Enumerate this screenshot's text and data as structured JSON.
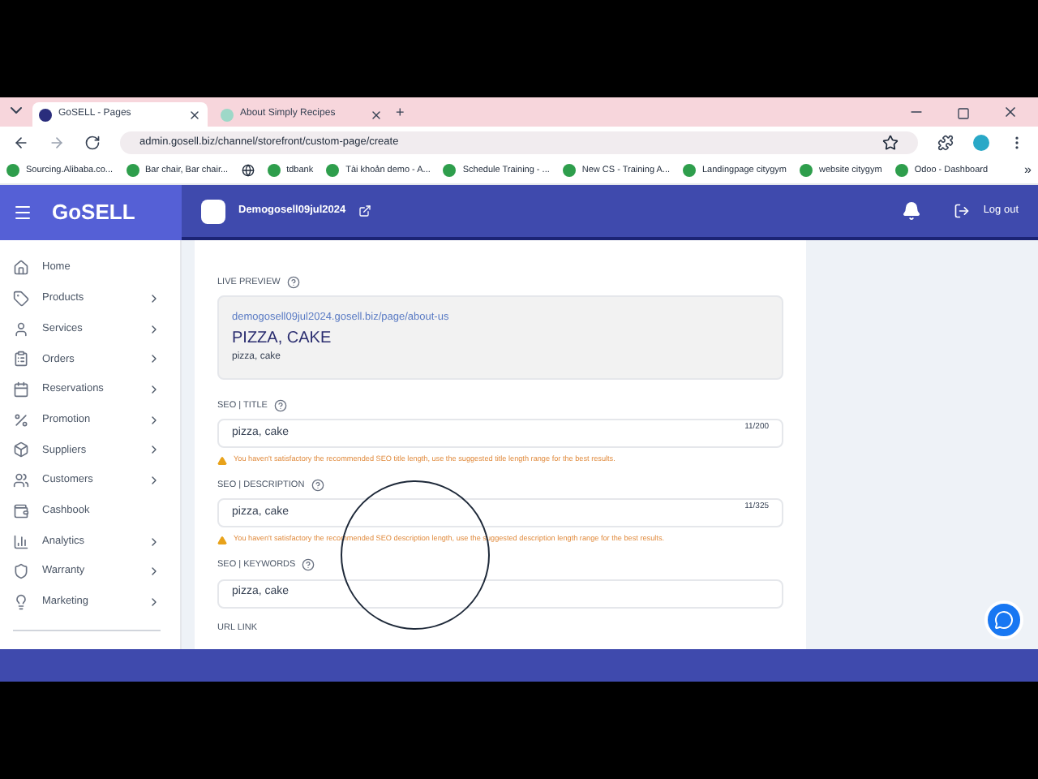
{
  "browser": {
    "tabs": [
      {
        "label": "GoSELL - Pages",
        "selected": true
      },
      {
        "label": "About Simply Recipes",
        "selected": false
      }
    ],
    "new_tab": "+",
    "url": "admin.gosell.biz/channel/storefront/custom-page/create",
    "bookmarks": [
      {
        "kind": "link",
        "label": "Sourcing.Alibaba.co..."
      },
      {
        "kind": "link",
        "label": "Bar chair, Bar chair..."
      },
      {
        "kind": "icon"
      },
      {
        "kind": "link",
        "label": "tdbank"
      },
      {
        "kind": "link",
        "label": "Tài khoản demo - A..."
      },
      {
        "kind": "link",
        "label": "Schedule Training - ..."
      },
      {
        "kind": "link",
        "label": "New CS - Training A..."
      },
      {
        "kind": "link",
        "label": "Landingpage citygym"
      },
      {
        "kind": "link",
        "label": "website citygym"
      },
      {
        "kind": "link",
        "label": "Odoo - Dashboard"
      }
    ],
    "more": "»"
  },
  "app": {
    "logo": "GoSELL",
    "store": "Demogosell09jul2024",
    "logout": "Log out"
  },
  "sidebar": {
    "items": [
      {
        "label": "Home",
        "has_children": false
      },
      {
        "label": "Products",
        "has_children": true
      },
      {
        "label": "Services",
        "has_children": true
      },
      {
        "label": "Orders",
        "has_children": true
      },
      {
        "label": "Reservations",
        "has_children": true
      },
      {
        "label": "Promotion",
        "has_children": true
      },
      {
        "label": "Suppliers",
        "has_children": true
      },
      {
        "label": "Customers",
        "has_children": true
      },
      {
        "label": "Cashbook",
        "has_children": false
      },
      {
        "label": "Analytics",
        "has_children": true
      },
      {
        "label": "Warranty",
        "has_children": true
      },
      {
        "label": "Marketing",
        "has_children": true
      }
    ]
  },
  "live_preview": {
    "label": "LIVE PREVIEW",
    "url": "demogosell09jul2024.gosell.biz/page/about-us",
    "title": "PIZZA, CAKE",
    "description": "pizza, cake"
  },
  "fields": [
    {
      "label": "SEO | TITLE",
      "value": "pizza, cake",
      "counter": "11/200",
      "warning": "You haven't satisfactory the recommended SEO title length, use the suggested title length range for the best results."
    },
    {
      "label": "SEO | DESCRIPTION",
      "value": "pizza, cake",
      "counter": "11/325",
      "warning": "You haven't satisfactory the recommended SEO description length, use the suggested description length range for the best results."
    },
    {
      "label": "SEO | KEYWORDS",
      "value": "pizza, cake"
    }
  ],
  "url_link": {
    "label": "URL LINK"
  }
}
